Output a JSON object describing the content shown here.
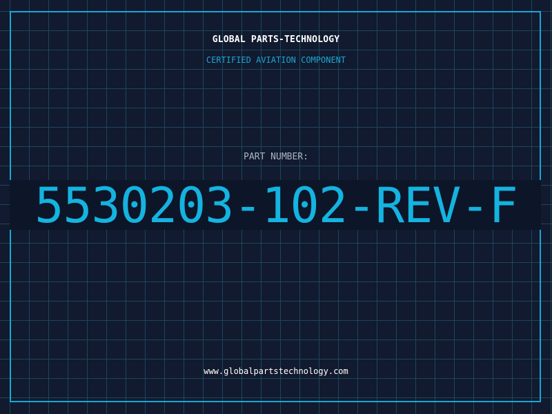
{
  "header": {
    "company": "GLOBAL PARTS-TECHNOLOGY",
    "subtitle": "CERTIFIED AVIATION COMPONENT"
  },
  "part": {
    "label": "PART NUMBER:",
    "number": "5530203-102-REV-F"
  },
  "footer": {
    "website": "www.globalpartstechnology.com"
  },
  "colors": {
    "background": "#111a2e",
    "grid": "#1d4660",
    "accent": "#14b3e0",
    "label": "#a9b7c6",
    "text": "#ffffff"
  }
}
